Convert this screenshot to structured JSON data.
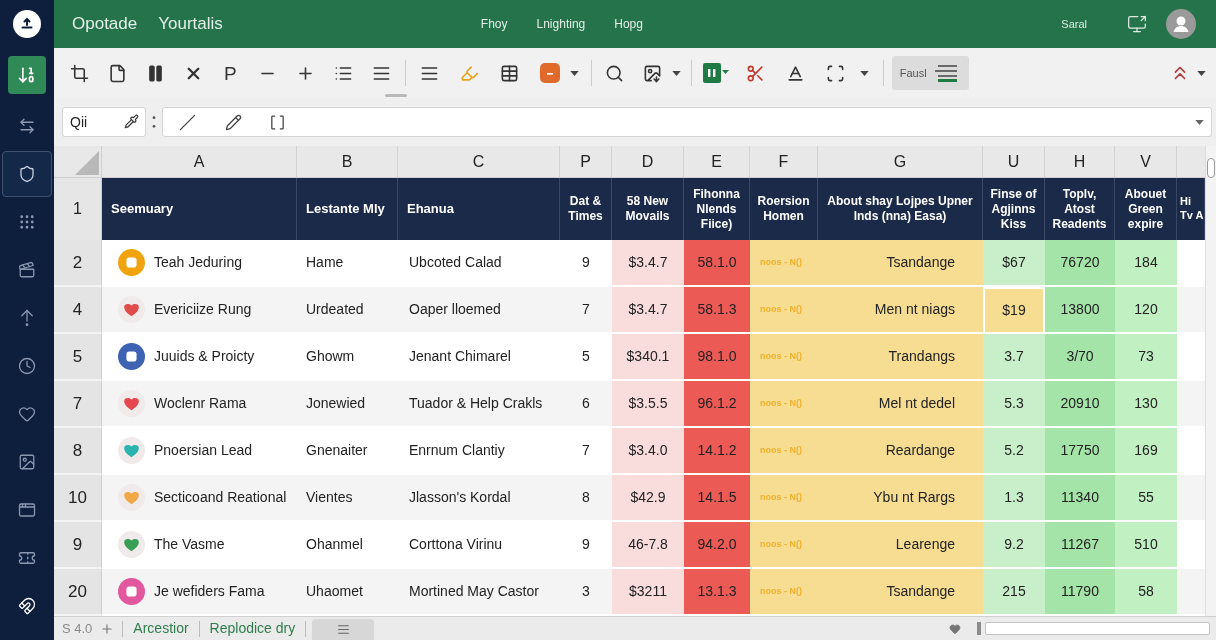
{
  "sidebar": {
    "items": [
      {
        "selected": false
      },
      {
        "selected": true
      },
      {
        "selected": false
      },
      {
        "selected": false
      },
      {
        "selected": false
      },
      {
        "selected": false
      },
      {
        "selected": false
      },
      {
        "selected": false
      },
      {
        "selected": false
      },
      {
        "selected": false
      },
      {
        "selected": false
      }
    ]
  },
  "top_bar": {
    "titles": [
      "Opotade",
      "Yourtalis"
    ],
    "menu": [
      "Fhoy",
      "Lnighting",
      "Hopg"
    ],
    "user_name": "Saral"
  },
  "toolbar": {
    "letter_button": "P",
    "style_box": "Fausl"
  },
  "formula_bar": {
    "name_box": "Qii"
  },
  "grid": {
    "columns": [
      "A",
      "B",
      "C",
      "P",
      "D",
      "E",
      "F",
      "G",
      "U",
      "H",
      "V"
    ],
    "header_row": {
      "number": "1",
      "cells": [
        "Seemuary",
        "Lestante Mly",
        "Ehanua",
        "Dat & Times",
        "58 New Movails",
        "Fihonna Nlends Fiice)",
        "Roersion Homen",
        "About shay Lojpes Upner lnds (nna) Easa)",
        "Finse of Agjinns Kiss",
        "Toplv, Atost Readents",
        "Abouet Green expire",
        "Hi Tv A"
      ]
    },
    "rows": [
      {
        "number": "2",
        "icon": {
          "kind": "solid",
          "color": "#f0a30f"
        },
        "marked": false,
        "cells": [
          "Teah Jeduring",
          "Hame",
          "Ubcoted Calad",
          "9",
          "$3.4.7",
          "58.1.0",
          "noos - N()",
          "Tsandange",
          "$67",
          "76720",
          "184"
        ]
      },
      {
        "number": "4",
        "icon": {
          "kind": "pale",
          "color": "#e04b4b"
        },
        "marked": true,
        "cells": [
          "Evericiize Rung",
          "Urdeated",
          "Oaper lloemed",
          "7",
          "$3.4.7",
          "58.1.3",
          "noos - N()",
          "Men nt niags",
          "$19",
          "13800",
          "120"
        ]
      },
      {
        "number": "5",
        "icon": {
          "kind": "solid",
          "color": "#3f63b3"
        },
        "marked": false,
        "cells": [
          "Juuids & Proicty",
          "Ghowm",
          "Jenant Chimarel",
          "5",
          "$340.1",
          "98.1.0",
          "noos - N()",
          "Trandangs",
          "3.7",
          "3/70",
          "73"
        ]
      },
      {
        "number": "7",
        "icon": {
          "kind": "pale",
          "color": "#e5474f"
        },
        "marked": false,
        "cells": [
          "Woclenr Rama",
          "Jonewied",
          "Tuador & Help Crakls",
          "6",
          "$3.5.5",
          "96.1.2",
          "noos - N()",
          "Mel nt dedel",
          "5.3",
          "20910",
          "130"
        ]
      },
      {
        "number": "8",
        "icon": {
          "kind": "pale",
          "color": "#2bb3ae"
        },
        "marked": false,
        "cells": [
          "Pnoersian Lead",
          "Gnenaiter",
          "Enrnum Clantiy",
          "7",
          "$3.4.0",
          "14.1.2",
          "noos - N()",
          "Reardange",
          "5.2",
          "17750",
          "169"
        ]
      },
      {
        "number": "10",
        "icon": {
          "kind": "pale",
          "color": "#f2a848"
        },
        "marked": false,
        "cells": [
          "Secticoand Reational",
          "Vientes",
          "Jlasson's Kordal",
          "8",
          "$42.9",
          "14.1.5",
          "noos - N()",
          "Ybu nt Rargs",
          "1.3",
          "11340",
          "55"
        ]
      },
      {
        "number": "9",
        "icon": {
          "kind": "pale",
          "color": "#3a9e55"
        },
        "marked": false,
        "cells": [
          "The Vasme",
          "Ohanmel",
          "Corttona Virinu",
          "9",
          "46-7.8",
          "94.2.0",
          "noos - N()",
          "Learenge",
          "9.2",
          "11267",
          "510"
        ]
      },
      {
        "number": "20",
        "icon": {
          "kind": "solid",
          "color": "#e1589e"
        },
        "marked": false,
        "cells": [
          "Je wefiders Fama",
          "Uhaomet",
          "Mortined May Castor",
          "3",
          "$3211",
          "13.1.3",
          "noos - N()",
          "Tsandange",
          "215",
          "11790",
          "58"
        ]
      }
    ]
  },
  "sheet_bar": {
    "position": "S 4.0",
    "tabs": [
      "Arcestior",
      "Replodice dry"
    ]
  }
}
